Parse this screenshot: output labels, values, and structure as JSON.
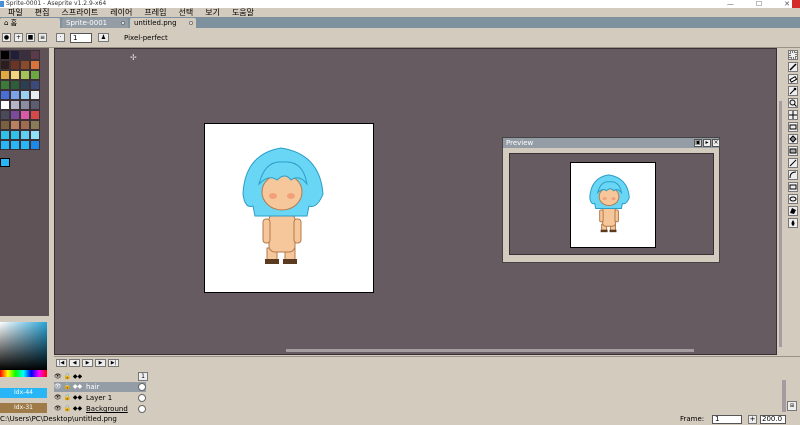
{
  "window": {
    "title": "Sprite-0001 - Aseprite v1.2.9-x64",
    "minimize": "—",
    "maximize": "☐",
    "close": "✕"
  },
  "menu": [
    "파일",
    "편집",
    "스프라이트",
    "레이어",
    "프레임",
    "선택",
    "보기",
    "도움말"
  ],
  "tabs": [
    {
      "label": "홈",
      "icon": "home-icon"
    },
    {
      "label": "Sprite-0001"
    },
    {
      "label": "untitled.png"
    }
  ],
  "context_bar": {
    "brush_size": "1",
    "pixel_perfect_label": "Pixel-perfect"
  },
  "palette": {
    "colors": [
      "#000000",
      "#1f1f3a",
      "#3b2f3f",
      "#5a3b4a",
      "#2d1e1e",
      "#6b3424",
      "#8a4b2d",
      "#d8733a",
      "#e0a840",
      "#f3d57e",
      "#a3c35a",
      "#6ba743",
      "#3c7a3a",
      "#2e5d3b",
      "#2c3e52",
      "#3a4b7a",
      "#4a6fd4",
      "#7aa3e8",
      "#9ad0f0",
      "#e8eef0",
      "#ffffff",
      "#b4b6c8",
      "#8a8ca0",
      "#5c5e70",
      "#4a4b5a",
      "#7a4b9a",
      "#d65aa8",
      "#d44a4a",
      "#7a6040",
      "#b88060",
      "#a06c50",
      "#8a7a5a",
      "#30c0e8",
      "#30c0e8",
      "#60d0f0",
      "#90e0f8",
      "#29b6f6",
      "#29b6f6",
      "#29b6f6",
      "#1e88e5"
    ],
    "fg_color": "#29b6f6",
    "fg_label": "Idx-44",
    "bg_label": "Idx-31"
  },
  "preview": {
    "title": "Preview"
  },
  "layers": [
    {
      "name": "hair",
      "selected": true
    },
    {
      "name": "Layer 1",
      "selected": false
    },
    {
      "name": "Background",
      "selected": false
    }
  ],
  "timeline": {
    "frame_header": "1"
  },
  "status": {
    "path": "C:\\Users\\PC\\Desktop\\untitled.png",
    "frame_label": "Frame:",
    "frame_value": "1",
    "zoom_value": "200.0"
  },
  "colors": {
    "accent": "#29b6f6",
    "chrome": "#d3cbbe",
    "workspace": "#675b62",
    "tab_active": "#949ca6",
    "skin": "#f6c79a",
    "hair": "#6ad6f5"
  }
}
